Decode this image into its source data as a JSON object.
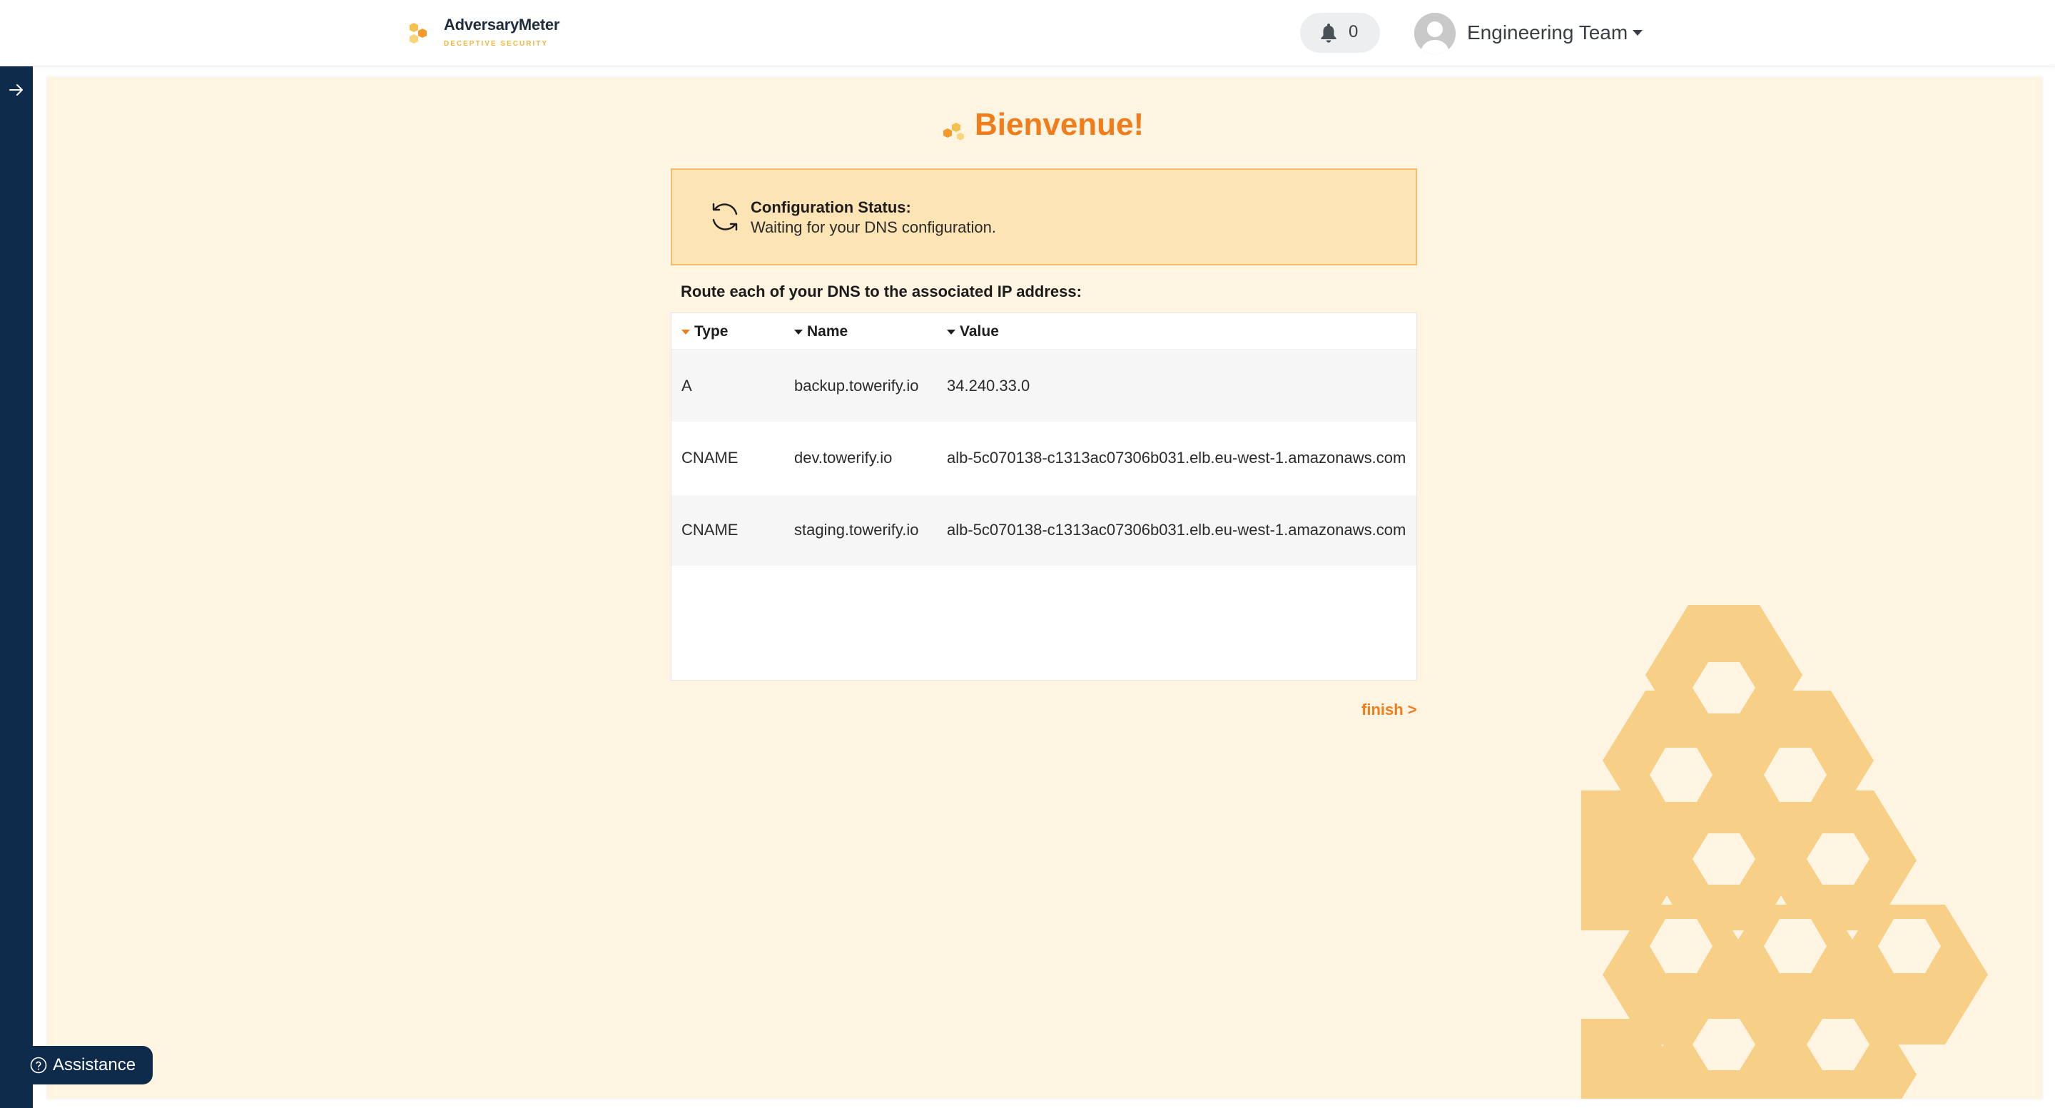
{
  "header": {
    "brand_name": "AdversaryMeter",
    "brand_tagline": "DECEPTIVE SECURITY",
    "notification_count": "0",
    "user_name": "Engineering Team"
  },
  "main": {
    "welcome": "Bienvenue!",
    "status": {
      "title": "Configuration Status:",
      "message": "Waiting for your DNS configuration."
    },
    "route_label": "Route each of your DNS to the associated IP address:",
    "table": {
      "columns": [
        "Type",
        "Name",
        "Value"
      ],
      "rows": [
        {
          "type": "A",
          "name": "backup.towerify.io",
          "value": "34.240.33.0"
        },
        {
          "type": "CNAME",
          "name": "dev.towerify.io",
          "value": "alb-5c070138-c1313ac07306b031.elb.eu-west-1.amazonaws.com"
        },
        {
          "type": "CNAME",
          "name": "staging.towerify.io",
          "value": "alb-5c070138-c1313ac07306b031.elb.eu-west-1.amazonaws.com"
        }
      ]
    },
    "finish_label": "finish >"
  },
  "assistance_label": "Assistance",
  "colors": {
    "accent": "#f07c1a",
    "sidebar": "#0f2b4c",
    "background": "#fdf4e1",
    "status_bg": "#fde4b5",
    "honeycomb": "#f8cf86"
  },
  "icons": {
    "logo": "bee-hex-logo-icon",
    "notifications": "bell-icon",
    "avatar": "user-avatar-icon",
    "sidebar_toggle": "arrow-right-icon",
    "welcome": "bee-icon",
    "status": "sync-icon",
    "assistance": "question-circle-icon"
  }
}
